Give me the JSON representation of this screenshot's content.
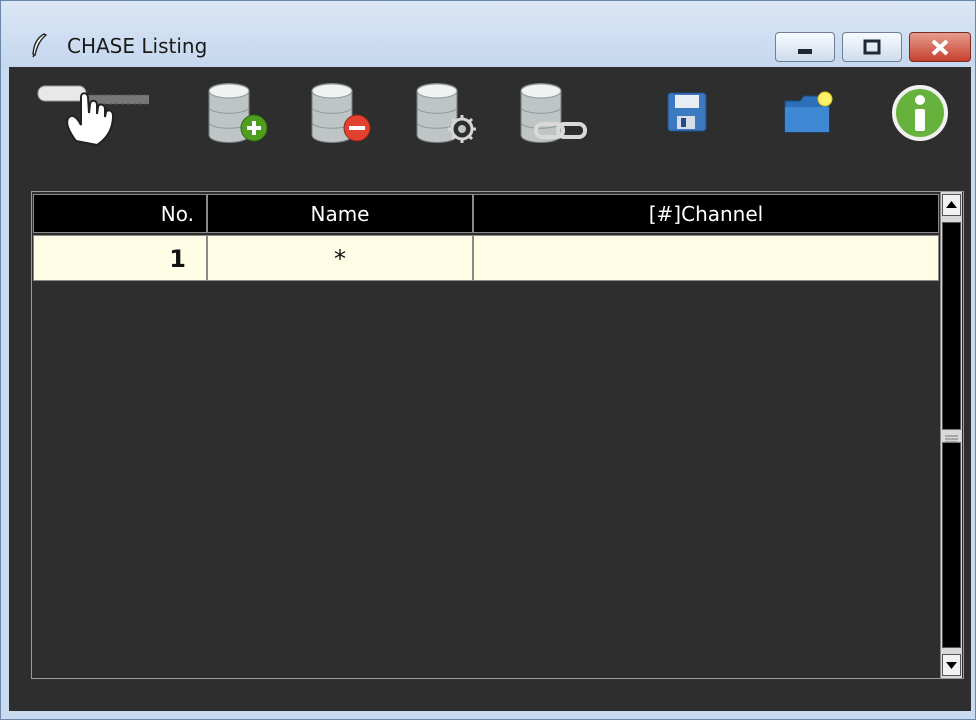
{
  "window": {
    "title": "CHASE Listing",
    "controls": {
      "minimize": "minimize",
      "maximize": "maximize",
      "close": "close"
    }
  },
  "toolbar": {
    "items": [
      {
        "name": "hand-pointer-icon"
      },
      {
        "name": "database-add-icon"
      },
      {
        "name": "database-remove-icon"
      },
      {
        "name": "database-settings-icon"
      },
      {
        "name": "database-link-icon"
      },
      {
        "name": "save-icon"
      },
      {
        "name": "new-folder-icon"
      },
      {
        "name": "info-icon"
      }
    ]
  },
  "table": {
    "columns": [
      "No.",
      "Name",
      "[#]Channel"
    ],
    "rows": [
      {
        "no": "1",
        "name": "*",
        "channel": ""
      }
    ]
  },
  "colors": {
    "background": "#2e2e2e",
    "header": "#000000",
    "row": "#fffde6"
  }
}
